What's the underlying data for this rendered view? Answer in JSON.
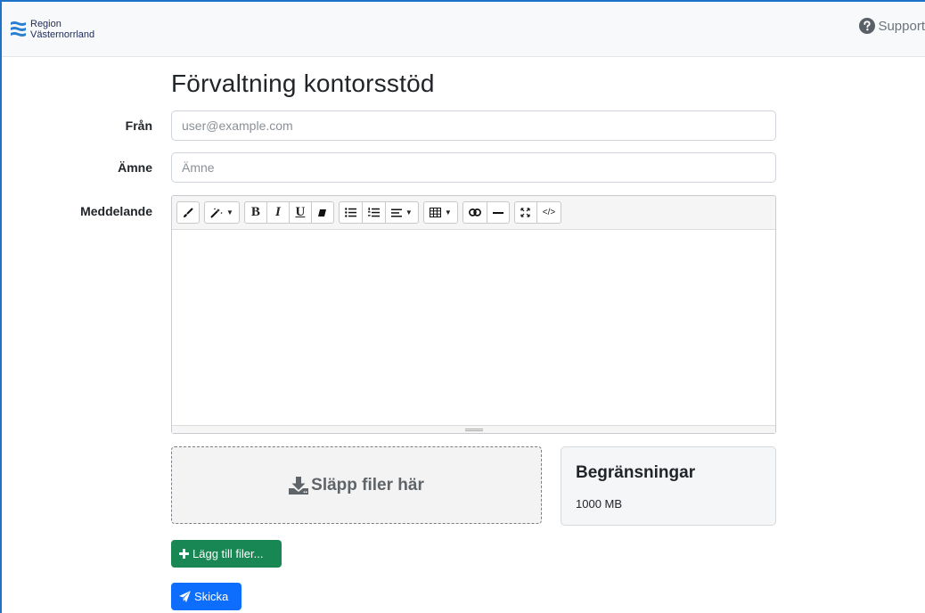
{
  "navbar": {
    "logo_line1": "Region",
    "logo_line2": "Västernorrland",
    "support_label": "Support",
    "support_icon": "question-circle-icon"
  },
  "page": {
    "title": "Förvaltning kontorsstöd"
  },
  "form": {
    "from_label": "Från",
    "from_placeholder": "user@example.com",
    "subject_label": "Ämne",
    "subject_placeholder": "Ämne",
    "message_label": "Meddelande"
  },
  "editor": {
    "toolbar_icons": [
      "brush-icon",
      "magic-wand-icon",
      "bold-icon",
      "italic-icon",
      "underline-icon",
      "eraser-icon",
      "unordered-list-icon",
      "ordered-list-icon",
      "align-icon",
      "table-icon",
      "link-icon",
      "horizontal-rule-icon",
      "fullscreen-icon",
      "code-view-icon"
    ],
    "bold": "B",
    "italic": "I",
    "underline": "U",
    "code": "</>"
  },
  "upload": {
    "drop_label": "Släpp filer här",
    "drop_icon": "download-icon",
    "limits_title": "Begränsningar",
    "limits_value": "1000 MB"
  },
  "actions": {
    "add_files_label": "Lägg till filer...",
    "send_label": "Skicka"
  },
  "colors": {
    "green": "#198754",
    "blue": "#0d6efd",
    "frame": "#1e73c8"
  }
}
